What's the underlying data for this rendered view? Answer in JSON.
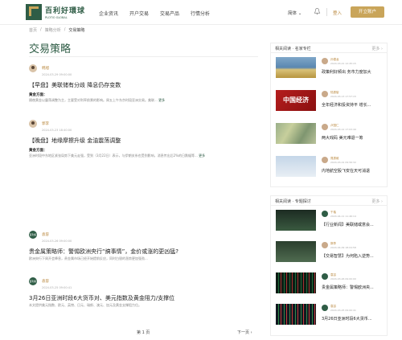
{
  "header": {
    "logo_cn": "百利好環球",
    "logo_en": "PLOTIO GLOBAL",
    "logo_mark": "PLOTIO",
    "nav": [
      "企业资讯",
      "开户交易",
      "交易产品",
      "行情分析"
    ],
    "lang": "简体 ⌄",
    "login": "登入",
    "open_account": "开立账户"
  },
  "breadcrumb": [
    "首页",
    "策略分析",
    "交易策略"
  ],
  "page_title": "交易策略",
  "articles": [
    {
      "author": "韩旭",
      "time": "2024-03-29 09:00:00",
      "title": "【早盘】美联储有分歧 降息仍存变数",
      "label": "黄金方面：",
      "desc": "隔夜黄金以震荡调整为主，主要受对利率前景的影响。周五上午东京时段亚洲交易。美联...",
      "more": "更多"
    },
    {
      "author": "郭李",
      "time": "2024-03-23 18:40:00",
      "title": "【晚盘】地缘摩擦升级 金油震荡调整",
      "label": "黄金方面：",
      "desc": "亚洲时段中东地区紧张局势下美元走强，受到（3月22日）表示，与伊朗关系也受到影响，消息传出后2%的日跌幅等...",
      "more": "更多"
    },
    {
      "author": "袁容",
      "time": "2024-03-26 09:00:00",
      "title": "贵金属策略师：警惕欧洲央行“搞事情”，金价或涨的更凶猛?",
      "desc": "欧洲央行下周开会降息，贵金属市场已经开始提前反应，同时白银的涨势更加强劲...",
      "avatar": "百利好"
    },
    {
      "author": "袁容",
      "time": "2024-03-25 09:00:41",
      "title": "3月26日亚洲时段6大货币对、美元指数及黄金阻力/支撑位",
      "desc": "本文提供美元指数、欧元、英镑、日元、瑞郎、澳元、加元及黄金支撑阻力位。",
      "avatar": "百利好"
    }
  ],
  "pager": {
    "current": "第 1 页",
    "next": "下一页 ›"
  },
  "panel1": {
    "title": "相关阅读 · 名家专栏",
    "more": "更多 ›",
    "items": [
      {
        "name": "孙德龙",
        "time": "2024-03-21 12:45:15",
        "title": "政策利好频出 务市力度加大"
      },
      {
        "name": "陆振鋆",
        "time": "2024-03-13 17:57:15",
        "title": "全年经济和投资持平 增长..."
      },
      {
        "name": "卢国仁",
        "time": "2024-03-12 17:03:49",
        "title": "两大戏码 美元难退一筹"
      },
      {
        "name": "晁振维",
        "time": "2024-03-01 09:56:32",
        "title": "内地航空股飞安在天可消退"
      }
    ]
  },
  "panel2": {
    "title": "相关阅读 · 专题探讨",
    "more": "更多 ›",
    "items": [
      {
        "name": "千柚",
        "time": "2024-04-11 11:46:14",
        "title": "【行业新闻】美联储或意会...",
        "av": "百"
      },
      {
        "name": "郭李",
        "time": "2024-04-09 18:04:58",
        "title": "【交易智慧】为何陷入逆势..."
      },
      {
        "name": "袁容",
        "time": "2024-03-26 09:00:00",
        "title": "贵金属策略师：警惕欧洲央...",
        "av": "百"
      },
      {
        "name": "袁容",
        "time": "2024-03-25 09:00:41",
        "title": "3月26日亚洲时段6大货币...",
        "av": "百"
      }
    ]
  }
}
